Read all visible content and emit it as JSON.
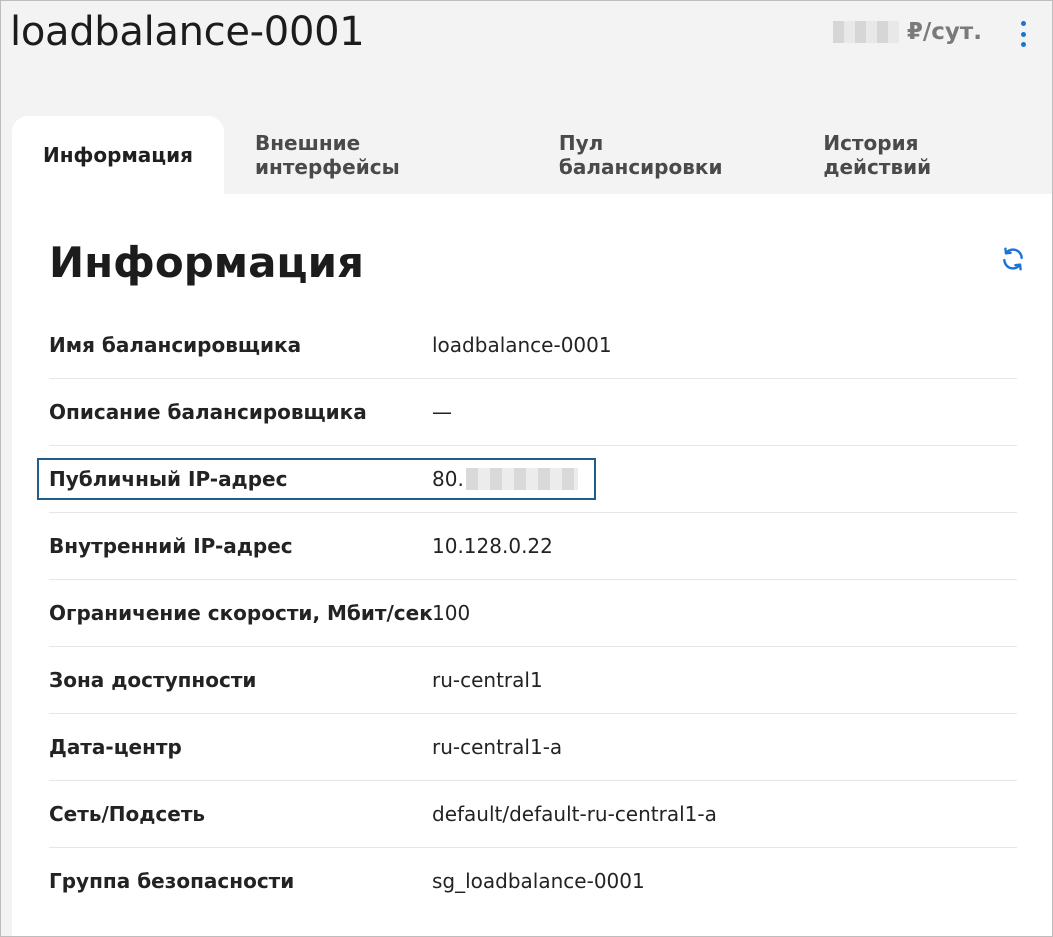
{
  "header": {
    "title": "loadbalance-0001",
    "price_suffix": "₽/сут."
  },
  "tabs": [
    {
      "label": "Информация",
      "active": true
    },
    {
      "label": "Внешние интерфейсы",
      "active": false
    },
    {
      "label": "Пул балансировки",
      "active": false
    },
    {
      "label": "История действий",
      "active": false
    }
  ],
  "panel": {
    "title": "Информация",
    "rows": [
      {
        "key": "Имя балансировщика",
        "value": "loadbalance-0001"
      },
      {
        "key": "Описание балансировщика",
        "value": "—"
      },
      {
        "key": "Публичный IP-адрес",
        "value": "80."
      },
      {
        "key": "Внутренний IP-адрес",
        "value": "10.128.0.22"
      },
      {
        "key": "Ограничение скорости, Мбит/сек",
        "value": "100"
      },
      {
        "key": "Зона доступности",
        "value": "ru-central1"
      },
      {
        "key": "Дата-центр",
        "value": "ru-central1-a"
      },
      {
        "key": "Сеть/Подсеть",
        "value": "default/default-ru-central1-a"
      },
      {
        "key": "Группа безопасности",
        "value": "sg_loadbalance-0001"
      }
    ]
  },
  "icons": {
    "menu": "kebab-menu-icon",
    "refresh": "refresh-icon"
  },
  "colors": {
    "accent": "#1a73d9",
    "highlight_border": "#1f5e8c"
  }
}
